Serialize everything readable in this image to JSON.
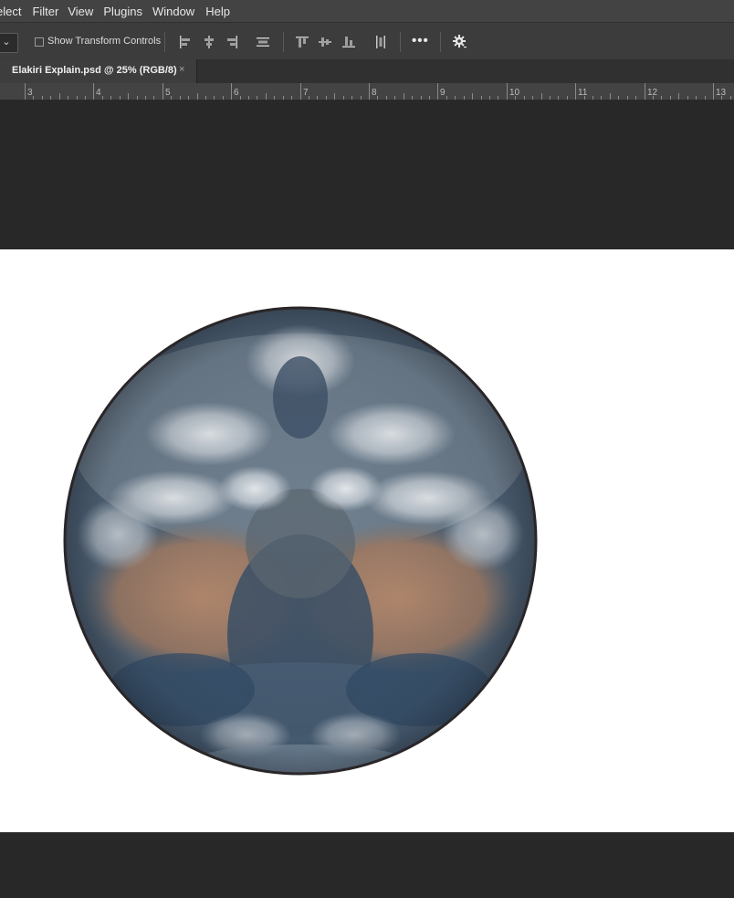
{
  "menu": {
    "items": [
      "elect",
      "Filter",
      "View",
      "Plugins",
      "Window",
      "Help"
    ]
  },
  "options_bar": {
    "dropdown_glyph": "⌄",
    "show_transform_controls": {
      "label": "Show Transform Controls",
      "checked": false
    },
    "align_icons": [
      "align-left-edges-icon",
      "align-horizontal-centers-icon",
      "align-right-edges-icon",
      "distribute-vertical-icon",
      "align-top-edges-icon",
      "align-vertical-centers-icon",
      "align-bottom-edges-icon",
      "distribute-horizontal-icon"
    ],
    "more_label": "•••",
    "settings_icon": "gear-icon"
  },
  "tab": {
    "title": "Elakiri Explain.psd @ 25% (RGB/8)",
    "close_glyph": "×"
  },
  "ruler": {
    "labels": [
      "3",
      "4",
      "5",
      "6",
      "7",
      "8",
      "9",
      "10",
      "11",
      "12",
      "13"
    ]
  },
  "canvas": {
    "document_color": "#ffffff",
    "pasteboard_color": "#282828",
    "image": "mirrored-earth-globe"
  }
}
